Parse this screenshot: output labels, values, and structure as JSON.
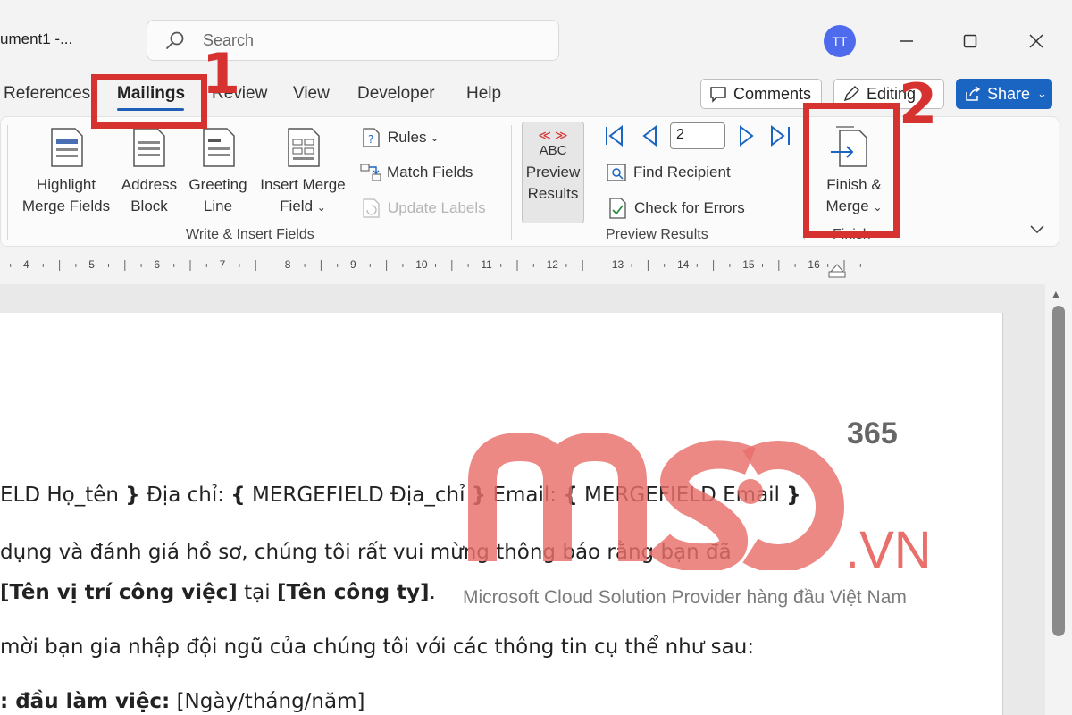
{
  "title_bar": {
    "doc_title": "ument1  -...",
    "search_placeholder": "Search",
    "avatar_initials": "TT"
  },
  "tabs": [
    {
      "label": "References"
    },
    {
      "label": "Mailings",
      "active": true
    },
    {
      "label": "Review"
    },
    {
      "label": "View"
    },
    {
      "label": "Developer"
    },
    {
      "label": "Help"
    }
  ],
  "header_actions": {
    "comments": "Comments",
    "editing": "Editing",
    "share": "Share"
  },
  "ribbon": {
    "write_insert": {
      "highlight": [
        "Highlight",
        "Merge Fields"
      ],
      "address": [
        "Address",
        "Block"
      ],
      "greeting": [
        "Greeting",
        "Line"
      ],
      "insert_merge": [
        "Insert Merge",
        "Field"
      ],
      "rules": "Rules",
      "match_fields": "Match Fields",
      "update_labels": "Update Labels",
      "group_label": "Write & Insert Fields"
    },
    "preview": {
      "abc": "ABC",
      "preview_results": [
        "Preview",
        "Results"
      ],
      "record_number": "2",
      "find_recipient": "Find Recipient",
      "check_errors": "Check for Errors",
      "group_label": "Preview Results"
    },
    "finish": {
      "finish_merge": [
        "Finish &",
        "Merge"
      ],
      "group_label": "Finish"
    }
  },
  "ruler": [
    "4",
    "5",
    "6",
    "7",
    "8",
    "9",
    "10",
    "11",
    "12",
    "13",
    "14",
    "15",
    "16"
  ],
  "document": {
    "line1": {
      "p1": "ELD Họ_tên ",
      "p2": "}",
      "p3": " Địa chỉ: ",
      "p4": "{",
      "p5": " MERGEFIELD Địa_chỉ ",
      "p6": "}",
      "p7": " Email: ",
      "p8": "{",
      "p9": " MERGEFIELD Email ",
      "p10": "}"
    },
    "line2": "dụng và đánh giá hồ sơ, chúng tôi rất vui mừng thông báo rằng bạn đã",
    "line3": {
      "p1": "[Tên vị trí công việc]",
      "p2": " tại ",
      "p3": "[Tên công ty]",
      "p4": "."
    },
    "line4": "mời bạn gia nhập đội ngũ của chúng tôi với các thông tin cụ thể như sau:",
    "line5": {
      "p1": ": đầu làm việc:",
      "p2": " [Ngày/tháng/năm]"
    }
  },
  "annotations": {
    "step1": "1",
    "step2": "2",
    "color": "#d6322f"
  },
  "watermark": {
    "superscript": "365",
    "domain": ".VN",
    "tagline": "Microsoft Cloud Solution Provider hàng đầu Việt Nam",
    "color": "#e86f6a"
  }
}
